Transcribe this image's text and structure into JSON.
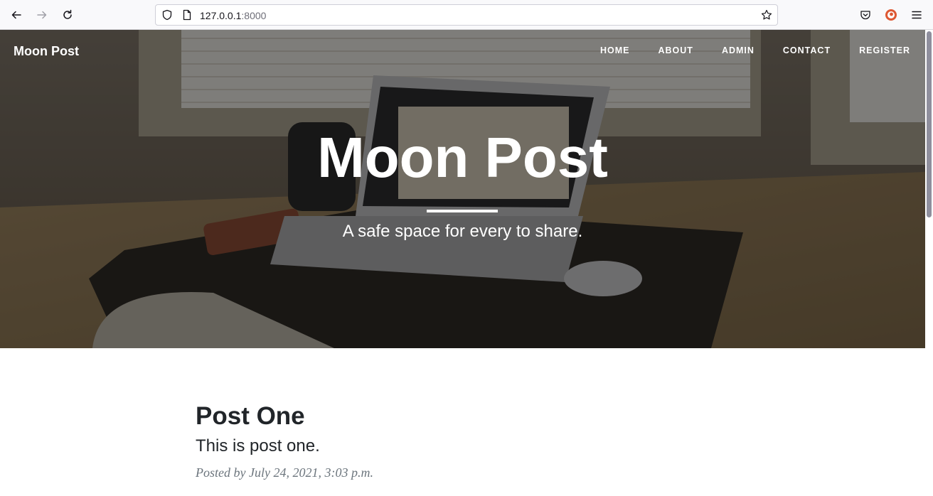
{
  "browser": {
    "url_host": "127.0.0.1",
    "url_port": ":8000"
  },
  "site": {
    "brand": "Moon Post",
    "nav": [
      {
        "label": "HOME"
      },
      {
        "label": "ABOUT"
      },
      {
        "label": "ADMIN"
      },
      {
        "label": "CONTACT"
      },
      {
        "label": "REGISTER"
      }
    ]
  },
  "hero": {
    "title": "Moon Post",
    "subtitle": "A safe space for every to share."
  },
  "posts": [
    {
      "title": "Post One",
      "subtitle": "This is post one.",
      "meta": "Posted by July 24, 2021, 3:03 p.m."
    }
  ],
  "colors": {
    "text": "#212529",
    "meta": "#6c757d",
    "hero_overlay": "#000000"
  }
}
